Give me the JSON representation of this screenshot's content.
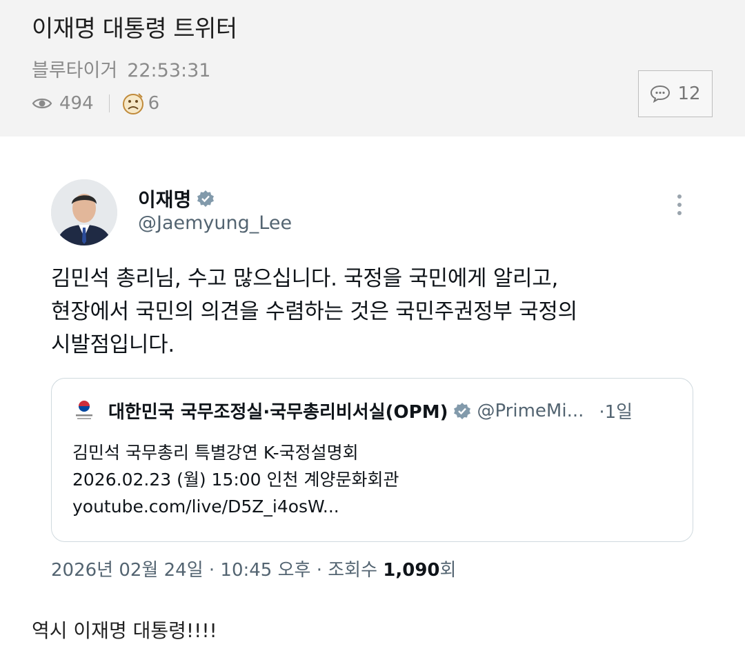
{
  "post": {
    "title": "이재명 대통령 트위터",
    "author": "블루타이거",
    "time": "22:53:31",
    "views": "494",
    "reactions": "6",
    "comment_count": "12"
  },
  "tweet": {
    "name": "이재명",
    "handle": "@Jaemyung_Lee",
    "text_lines": [
      "김민석 총리님, 수고 많으십니다. 국정을 국민에게 알리고,",
      "현장에서 국민의 의견을 수렴하는 것은 국민주권정부 국정의",
      "시발점입니다."
    ],
    "quote": {
      "name": "대한민국 국무조정실·국무총리비서실(OPM)",
      "handle": "@PrimeMi...",
      "time": "·1일",
      "lines": [
        "김민석 국무총리 특별강연 K-국정설명회",
        "2026.02.23 (월) 15:00 인천 계양문화회관",
        "youtube.com/live/D5Z_i4osW..."
      ]
    },
    "meta_date": "2026년 02월 24일 · 10:45 오후 · 조회수 ",
    "meta_views": "1,090",
    "meta_suffix": "회"
  },
  "body_text": "역시 이재명 대통령!!!!",
  "icons": [
    "eye-icon",
    "reaction-emoji-icon",
    "comment-icon",
    "verified-badge-icon",
    "more-options-icon",
    "government-logo-icon"
  ],
  "colors": {
    "header_bg": "#f3f3f3",
    "verified": "#829aab",
    "muted": "#536471"
  }
}
